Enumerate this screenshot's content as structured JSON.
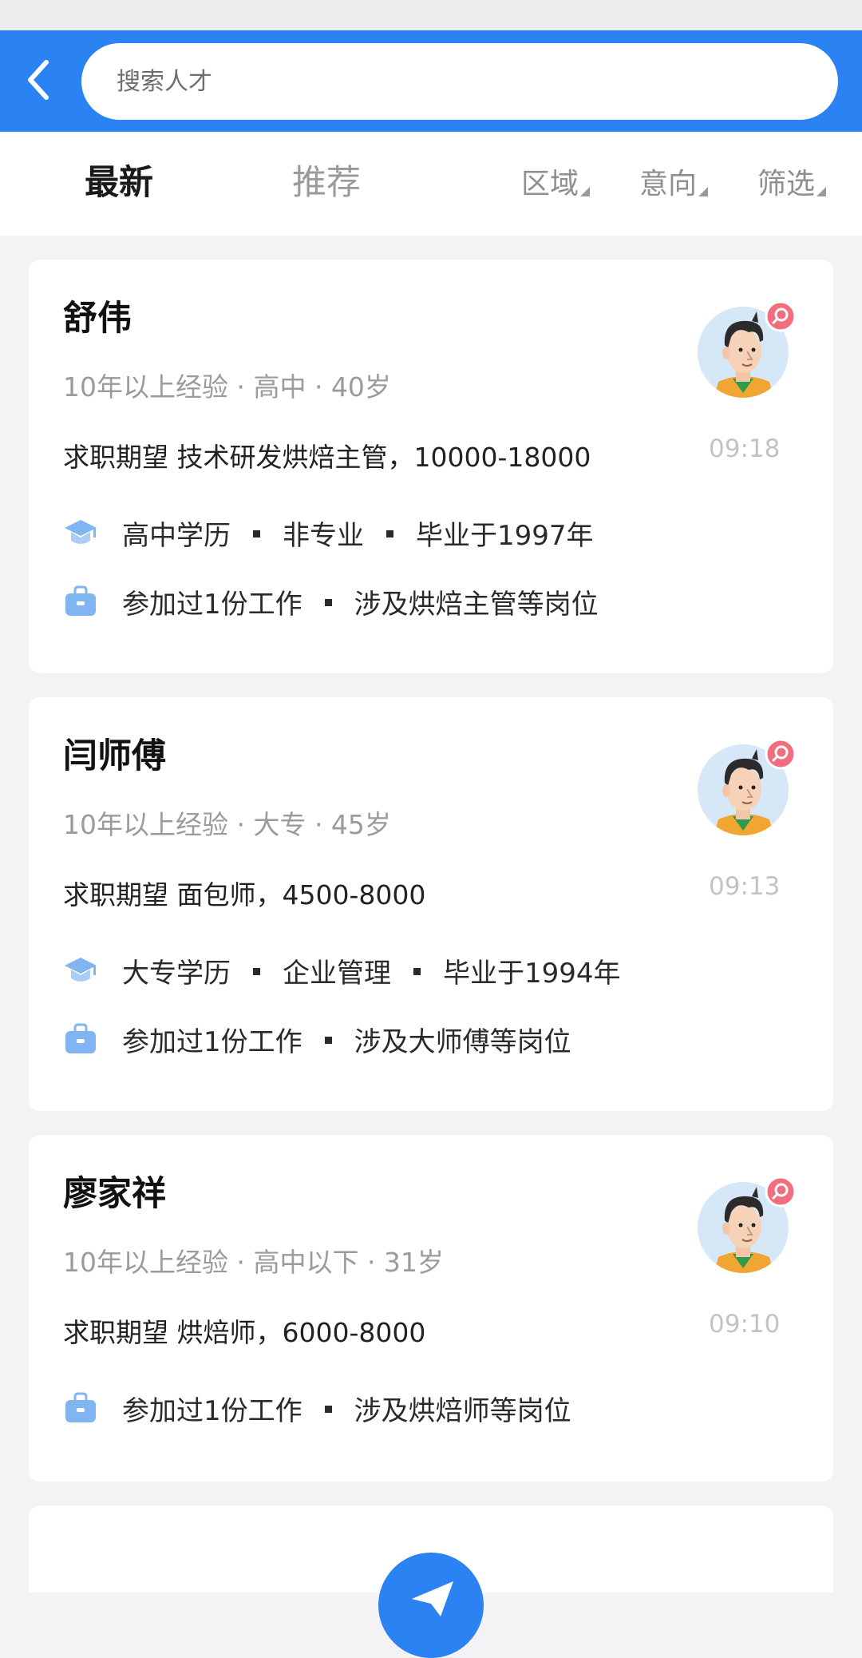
{
  "header": {
    "search_placeholder": "搜索人才"
  },
  "tabs": [
    {
      "label": "最新",
      "active": true
    },
    {
      "label": "推荐",
      "active": false
    }
  ],
  "filters": [
    {
      "label": "区域"
    },
    {
      "label": "意向"
    },
    {
      "label": "筛选"
    }
  ],
  "candidates": [
    {
      "name": "舒伟",
      "meta": "10年以上经验 · 高中 · 40岁",
      "expectation": "求职期望 技术研发烘焙主管，10000-18000",
      "time": "09:18",
      "education": [
        "高中学历",
        "非专业",
        "毕业于1997年"
      ],
      "work": [
        "参加过1份工作",
        "涉及烘焙主管等岗位"
      ]
    },
    {
      "name": "闫师傅",
      "meta": "10年以上经验 · 大专 · 45岁",
      "expectation": "求职期望 面包师，4500-8000",
      "time": "09:13",
      "education": [
        "大专学历",
        "企业管理",
        "毕业于1994年"
      ],
      "work": [
        "参加过1份工作",
        "涉及大师傅等岗位"
      ]
    },
    {
      "name": "廖家祥",
      "meta": "10年以上经验 · 高中以下 · 31岁",
      "expectation": "求职期望 烘焙师，6000-8000",
      "time": "09:10",
      "work": [
        "参加过1份工作",
        "涉及烘焙师等岗位"
      ]
    }
  ],
  "icons": {
    "back": "chevron-left-icon",
    "education": "graduation-cap-icon",
    "work": "briefcase-icon",
    "avatar_badge": "chat-bubble-icon",
    "fab": "send-icon"
  },
  "colors": {
    "primary": "#2b82f3",
    "badge": "#f26d7d",
    "icon_blue": "#7fb6f2"
  }
}
